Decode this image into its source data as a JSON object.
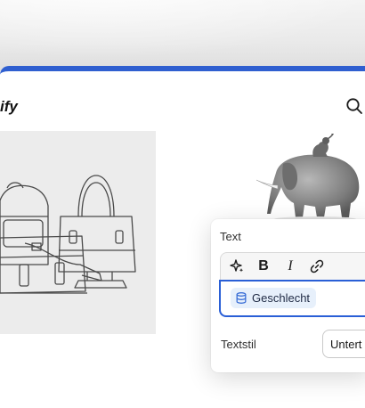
{
  "brand": {
    "text": "ify"
  },
  "header": {
    "search_icon": "search-icon"
  },
  "editor": {
    "field_label": "Text",
    "toolbar": {
      "icons": [
        "sparkle-icon",
        "bold-icon",
        "italic-icon",
        "link-icon"
      ],
      "bold_glyph": "B",
      "italic_glyph": "I"
    },
    "chip": {
      "icon": "database-icon",
      "label": "Geschlecht"
    },
    "style_label": "Textstil",
    "style_value": "Untert"
  },
  "colors": {
    "accent": "#2f5fd0",
    "chip_bg": "#e7f0fb",
    "chip_icon": "#3b6fd6"
  }
}
